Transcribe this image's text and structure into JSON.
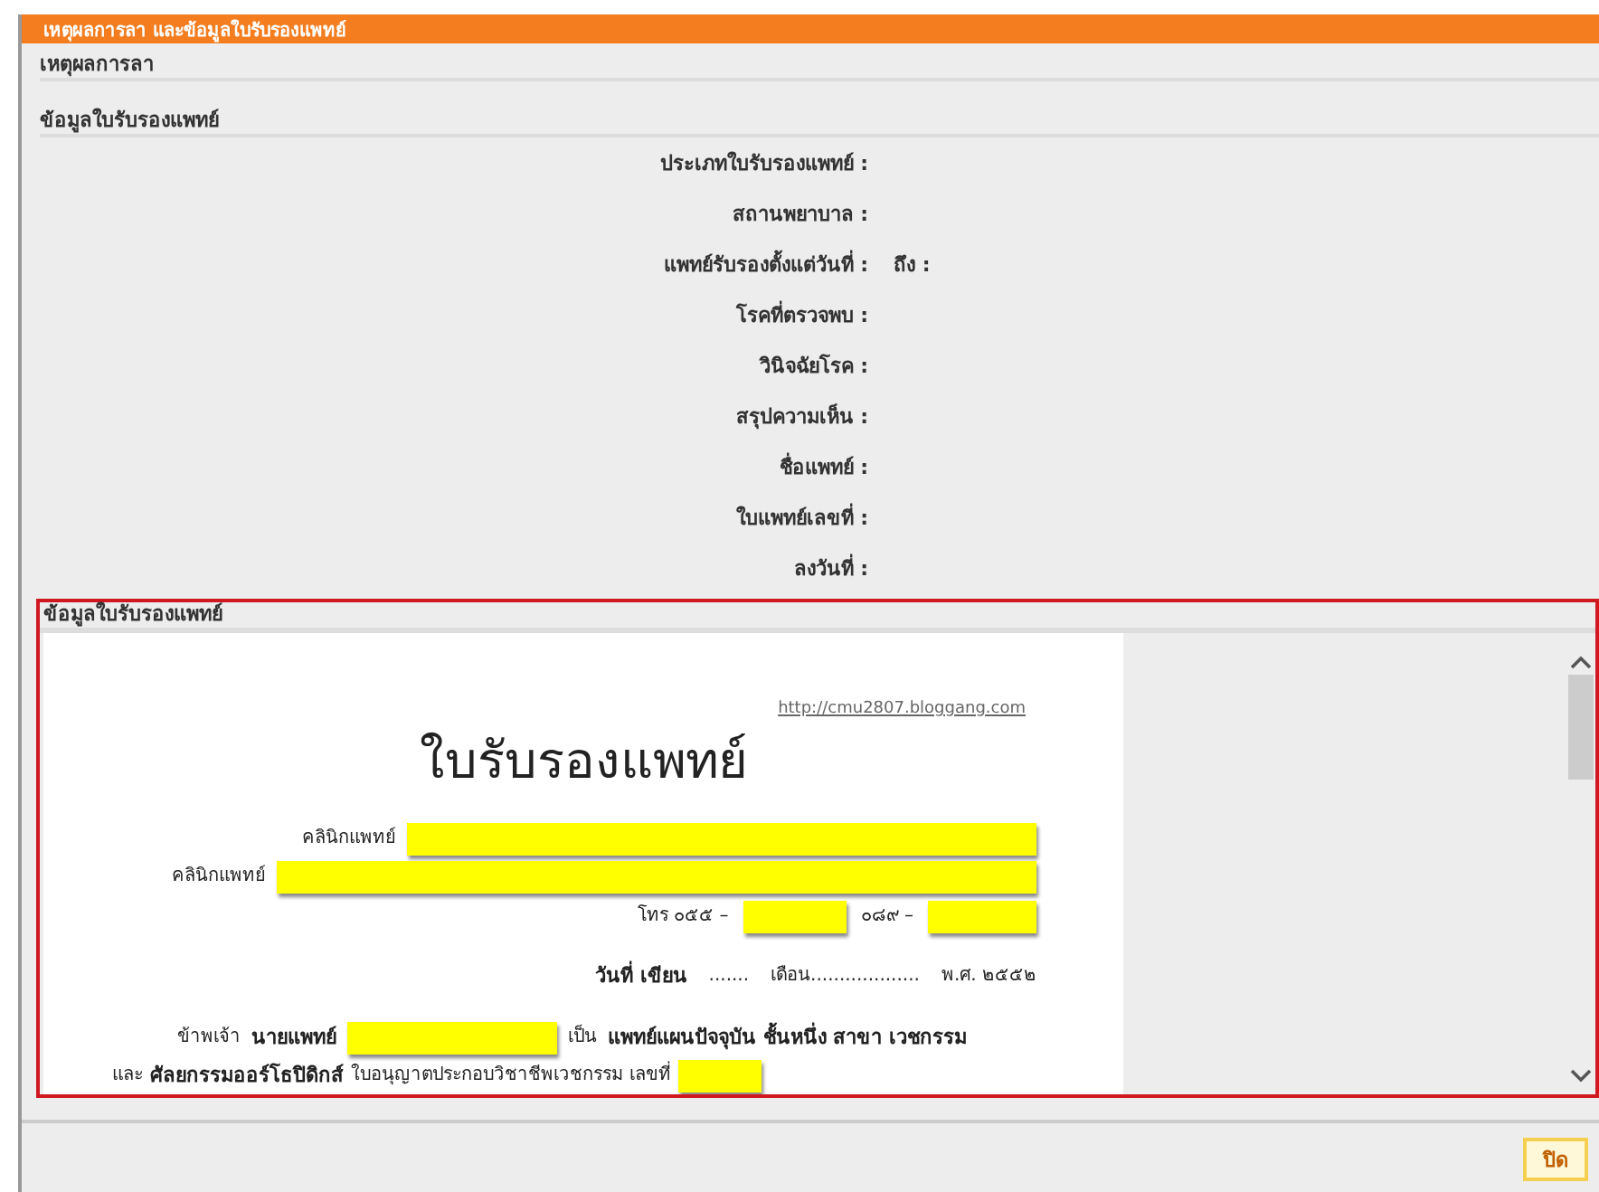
{
  "dialog": {
    "title": "เหตุผลการลา และข้อมูลใบรับรองแพทย์"
  },
  "sections": [
    {
      "heading": "เหตุผลการลา"
    },
    {
      "heading": "ข้อมูลใบรับรองแพทย์"
    }
  ],
  "fields": [
    {
      "label": "ประเภทใบรับรองแพทย์ :"
    },
    {
      "label": "สถานพยาบาล :"
    },
    {
      "label": "แพทย์รับรองตั้งแต่วันที่ :",
      "extra": "ถึง :"
    },
    {
      "label": "โรคที่ตรวจพบ :"
    },
    {
      "label": "วินิจฉัยโรค :"
    },
    {
      "label": "สรุปความเห็น :"
    },
    {
      "label": "ชื่อแพทย์ :"
    },
    {
      "label": "ใบแพทย์เลขที่ :"
    },
    {
      "label": "ลงวันที่ :"
    }
  ],
  "viewer": {
    "heading": "ข้อมูลใบรับรองแพทย์",
    "document": {
      "link": "http://cmu2807.bloggang.com",
      "title": "ใบรับรองแพทย์",
      "lines": [
        [
          {
            "kind": "text",
            "text": "คลินิกแพทย์"
          },
          {
            "kind": "redaction"
          }
        ],
        [
          {
            "kind": "text",
            "text": "คลินิกแพทย์"
          },
          {
            "kind": "redaction"
          }
        ],
        [
          {
            "kind": "text",
            "text": "โทร ๐๕๕ –"
          },
          {
            "kind": "redaction"
          },
          {
            "kind": "text",
            "text": "๐๘๙ –"
          },
          {
            "kind": "redaction"
          }
        ],
        [
          {
            "kind": "text",
            "text": "วันที่ เขียน",
            "bold": true
          },
          {
            "kind": "text",
            "text": "......."
          },
          {
            "kind": "text",
            "text": "เดือน..................."
          },
          {
            "kind": "text",
            "text": "พ.ศ. ๒๕๕๒"
          }
        ],
        [
          {
            "kind": "text",
            "text": "ข้าพเจ้า"
          },
          {
            "kind": "text",
            "text": "นายแพทย์",
            "bold": true
          },
          {
            "kind": "redaction"
          },
          {
            "kind": "text",
            "text": "เป็น"
          },
          {
            "kind": "text",
            "text": "แพทย์แผนปัจจุบัน ชั้นหนึ่ง สาขา เวชกรรม",
            "bold": true
          }
        ],
        [
          {
            "kind": "text",
            "text": "และ"
          },
          {
            "kind": "text",
            "text": "ศัลยกรรมออร์โธปิดิกส์",
            "bold": true
          },
          {
            "kind": "text",
            "text": "ใบอนุญาตประกอบวิชาชีพเวชกรรม เลขที่"
          },
          {
            "kind": "redaction"
          }
        ]
      ]
    }
  },
  "buttons": [
    {
      "label": "ปิด"
    }
  ]
}
